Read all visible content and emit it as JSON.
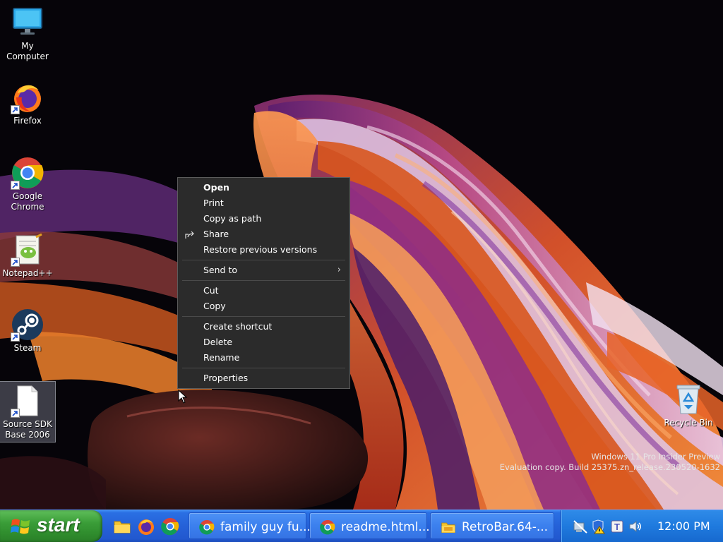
{
  "desktop_icons": [
    {
      "label": "My Computer",
      "icon": "monitor-icon",
      "shortcut": false
    },
    {
      "label": "Firefox",
      "icon": "firefox-icon",
      "shortcut": true
    },
    {
      "label": "Google Chrome",
      "icon": "chrome-icon",
      "shortcut": true
    },
    {
      "label": "Notepad++",
      "icon": "notepadpp-icon",
      "shortcut": true
    },
    {
      "label": "Steam",
      "icon": "steam-icon",
      "shortcut": true
    },
    {
      "label": "Source SDK Base 2006",
      "icon": "blank-file-icon",
      "shortcut": true,
      "selected": true
    },
    {
      "label": "Recycle Bin",
      "icon": "recycle-bin-icon",
      "shortcut": false
    }
  ],
  "watermark": {
    "line1": "Windows 11 Pro Insider Preview",
    "line2": "Evaluation copy. Build 25375.zn_release.230520-1632"
  },
  "context_menu": {
    "items": [
      {
        "label": "Open",
        "bold": true
      },
      {
        "label": "Print"
      },
      {
        "label": "Copy as path"
      },
      {
        "label": "Share",
        "icon": "share-icon"
      },
      {
        "label": "Restore previous versions"
      },
      {
        "label": "Send to",
        "submenu": true
      },
      {
        "label": "Cut"
      },
      {
        "label": "Copy"
      },
      {
        "label": "Create shortcut"
      },
      {
        "label": "Delete"
      },
      {
        "label": "Rename"
      },
      {
        "label": "Properties"
      }
    ]
  },
  "taskbar": {
    "start_label": "start",
    "quick_launch": [
      "folder-icon",
      "firefox-icon",
      "chrome-icon"
    ],
    "tasks": [
      {
        "title": "family guy fu...",
        "icon": "chrome-icon"
      },
      {
        "title": "readme.html...",
        "icon": "chrome-icon"
      },
      {
        "title": "RetroBar.64-...",
        "icon": "folder-icon"
      }
    ],
    "tray_icons": [
      "network-off-icon",
      "security-warning-icon",
      "teams-icon",
      "volume-icon"
    ],
    "clock": "12:00 PM"
  },
  "colors": {
    "taskbar_blue": "#2561d8",
    "start_green": "#3a9d38",
    "menu_bg": "#2b2b2b",
    "tray_blue": "#1f7ade"
  }
}
